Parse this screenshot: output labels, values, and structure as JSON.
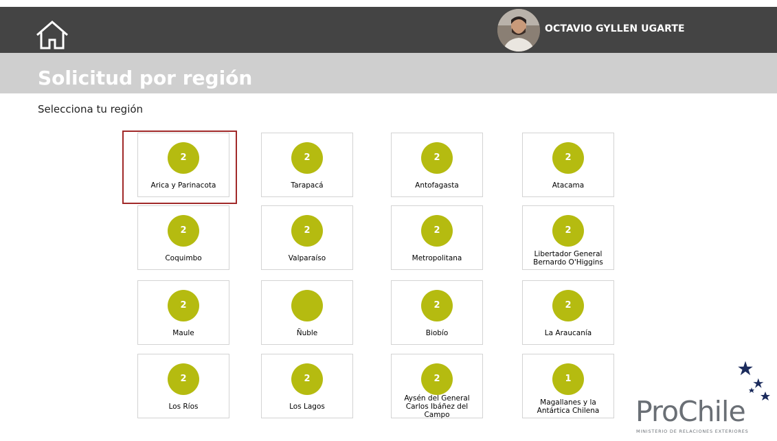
{
  "header": {
    "user_name": "OCTAVIO GYLLEN UGARTE",
    "bg_color": "#444444"
  },
  "page": {
    "title": "Solicitud por región",
    "subtitle": "Selecciona tu región"
  },
  "accent_color": "#b5bb10",
  "selected_region": "Arica y Parinacota",
  "regions": [
    {
      "name": "Arica y Parinacota",
      "count": "2"
    },
    {
      "name": "Tarapacá",
      "count": "2"
    },
    {
      "name": "Antofagasta",
      "count": "2"
    },
    {
      "name": "Atacama",
      "count": "2"
    },
    {
      "name": "Coquimbo",
      "count": "2"
    },
    {
      "name": "Valparaíso",
      "count": "2"
    },
    {
      "name": "Metropolitana",
      "count": "2"
    },
    {
      "name": "Libertador General Bernardo O'Higgins",
      "count": "2"
    },
    {
      "name": "Maule",
      "count": "2"
    },
    {
      "name": "Ñuble",
      "count": ""
    },
    {
      "name": "Biobío",
      "count": "2"
    },
    {
      "name": "La Araucanía",
      "count": "2"
    },
    {
      "name": "Los Ríos",
      "count": "2"
    },
    {
      "name": "Los Lagos",
      "count": "2"
    },
    {
      "name": "Aysén del General Carlos Ibáñez del Campo",
      "count": "2"
    },
    {
      "name": "Magallanes y la Antártica Chilena",
      "count": "1"
    }
  ],
  "logo": {
    "brand": "ProChile",
    "subtitle": "MINISTERIO DE RELACIONES EXTERIORES"
  }
}
